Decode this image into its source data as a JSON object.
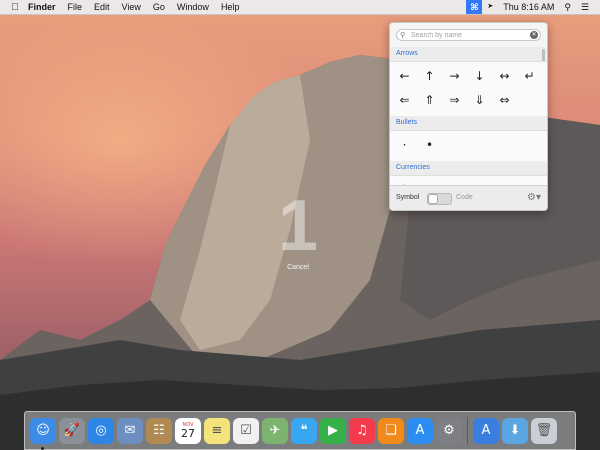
{
  "menubar": {
    "apple_icon": "",
    "items": [
      "Finder",
      "File",
      "Edit",
      "View",
      "Go",
      "Window",
      "Help"
    ],
    "status": {
      "characters_viewer_icon": "⌘",
      "cursor_icon": "➤",
      "clock": "Thu 8:16 AM",
      "spotlight_icon": "⚲",
      "notification_icon": "☰"
    }
  },
  "countdown": {
    "value": "1",
    "cancel_label": "Cancel"
  },
  "character_viewer": {
    "search_placeholder": "Search by name",
    "categories": [
      {
        "name": "Arrows",
        "glyphs": [
          "←",
          "↑",
          "→",
          "↓",
          "↔",
          "↵",
          "⇐",
          "⇑",
          "⇒",
          "⇓",
          "⇔"
        ]
      },
      {
        "name": "Bullets",
        "glyphs": [
          "·",
          "•"
        ]
      },
      {
        "name": "Currencies",
        "glyphs": [
          "$",
          "¢",
          "£",
          "¤",
          "¥",
          "€"
        ]
      }
    ],
    "footer": {
      "symbol_label": "Symbol",
      "code_label": "Code",
      "gear_icon": "⚙▾"
    }
  },
  "dock": {
    "apps": [
      {
        "name": "Finder",
        "glyph": "☺",
        "color": "#3c8ce7",
        "running": true
      },
      {
        "name": "Launchpad",
        "glyph": "🚀",
        "color": "#8b8f98"
      },
      {
        "name": "Safari",
        "glyph": "◎",
        "color": "#2d86e6"
      },
      {
        "name": "Mail",
        "glyph": "✉",
        "color": "#6c8fbf"
      },
      {
        "name": "Contacts",
        "glyph": "☷",
        "color": "#b08a52"
      },
      {
        "name": "Calendar",
        "glyph": "27",
        "color": "#ffffff",
        "month": "NOV"
      },
      {
        "name": "Notes",
        "glyph": "≡",
        "color": "#f4e27a"
      },
      {
        "name": "Reminders",
        "glyph": "☑",
        "color": "#f1f1f1"
      },
      {
        "name": "Maps",
        "glyph": "✈",
        "color": "#7cb46f"
      },
      {
        "name": "Messages",
        "glyph": "❝",
        "color": "#39a7ef"
      },
      {
        "name": "FaceTime",
        "glyph": "▶",
        "color": "#36b14a"
      },
      {
        "name": "iTunes",
        "glyph": "♫",
        "color": "#f43b4e"
      },
      {
        "name": "iBooks",
        "glyph": "❑",
        "color": "#f08a1d"
      },
      {
        "name": "App Store",
        "glyph": "A",
        "color": "#2b8df0"
      },
      {
        "name": "System Preferences",
        "glyph": "⚙",
        "color": "#7d7f85"
      }
    ],
    "right_items": [
      {
        "name": "Downloads",
        "glyph": "A",
        "color": "#3a7fe0"
      },
      {
        "name": "Documents",
        "glyph": "⬇",
        "color": "#5aa6e3"
      },
      {
        "name": "Trash",
        "glyph": "🗑",
        "color": "#c9cfd6"
      }
    ]
  }
}
